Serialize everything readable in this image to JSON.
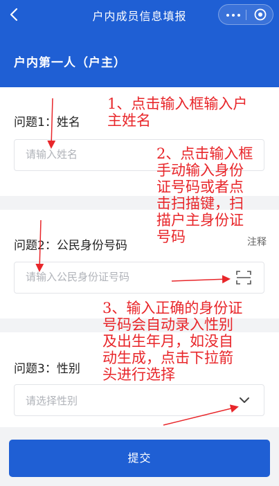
{
  "topbar": {
    "title": "户内成员信息填报",
    "back_icon": "chevron-left-icon",
    "more_icon": "more-dots-icon",
    "close_icon": "target-circle-icon"
  },
  "banner": {
    "title": "户内第一人（户主）"
  },
  "questions": [
    {
      "label": "问题1：姓名",
      "placeholder": "请输入姓名"
    },
    {
      "label": "问题2：公民身份号码",
      "placeholder": "请输入公民身份证号码",
      "note": "注释",
      "icon": "scan-icon"
    },
    {
      "label": "问题3：性别",
      "placeholder": "请选择性别",
      "icon": "chevron-down-icon"
    }
  ],
  "submit": {
    "label": "提交"
  },
  "annotations": [
    {
      "lines": [
        "1、点击输入框输入户",
        "主姓名"
      ]
    },
    {
      "lines": [
        "2、点击输入框",
        "手动输入身份",
        "证号码或者点",
        "击扫描键，扫",
        "描户主身份证",
        "号码"
      ]
    },
    {
      "lines": [
        "3、输入正确的身份证",
        "号码会自动录入性别",
        "及出生年月，如没自",
        "动生成，点击下拉箭",
        "头进行选择"
      ]
    }
  ],
  "colors": {
    "primary": "#1f5fd4",
    "annotation": "#e8262a",
    "background": "#f2f3f5"
  }
}
